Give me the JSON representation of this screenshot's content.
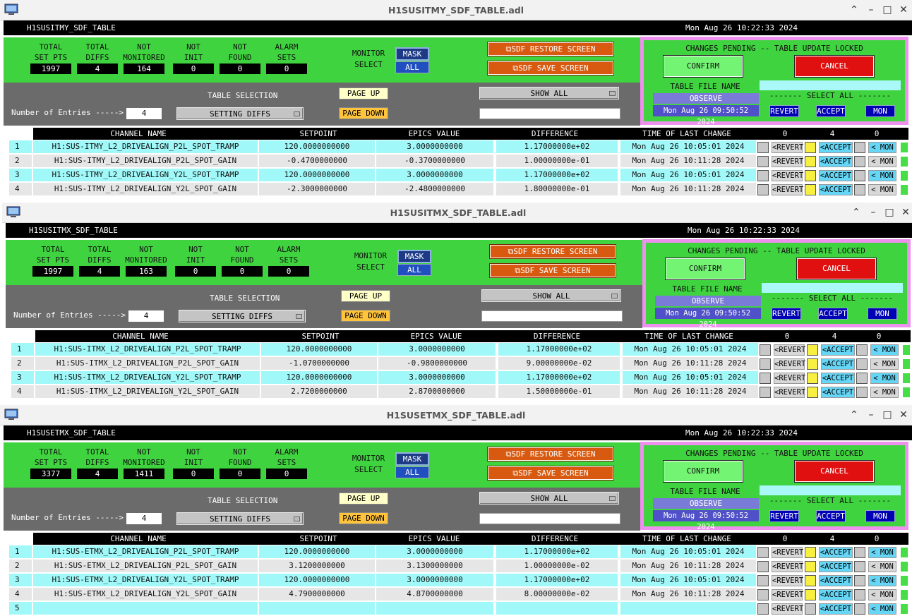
{
  "windows": [
    {
      "title": "H1SUSITMY_SDF_TABLE.adl",
      "header_name": "H1SUSITMY_SDF_TABLE",
      "header_date": "Mon Aug 26 10:22:33 2024",
      "stats": [
        {
          "label1": "TOTAL",
          "label2": "SET PTS",
          "value": "1997"
        },
        {
          "label1": "TOTAL",
          "label2": "DIFFS",
          "value": "4"
        },
        {
          "label1": "NOT",
          "label2": "MONITORED",
          "value": "164"
        },
        {
          "label1": "NOT",
          "label2": "INIT",
          "value": "0"
        },
        {
          "label1": "NOT",
          "label2": "FOUND",
          "value": "0"
        },
        {
          "label1": "ALARM",
          "label2": "SETS",
          "value": "0"
        }
      ],
      "monitor_select_1": "MONITOR",
      "monitor_select_2": "SELECT",
      "mask_label": "MASK",
      "all_label": "ALL",
      "restore_label": "⧉SDF RESTORE SCREEN",
      "save_label": "⧉SDF SAVE SCREEN",
      "table_selection_label": "TABLE SELECTION",
      "entries_label": "Number of Entries ----->",
      "entries_value": "4",
      "table_select_value": "SETTING DIFFS",
      "page_up": "PAGE UP",
      "page_down": "PAGE DOWN",
      "show_all": "SHOW ALL",
      "pending_text": "CHANGES PENDING -- TABLE UPDATE LOCKED",
      "confirm": "CONFIRM",
      "cancel": "CANCEL",
      "table_file_name": "TABLE FILE NAME",
      "observe": "OBSERVE",
      "select_all": "------- SELECT ALL -------",
      "file_date": "Mon Aug 26 09:50:52 2024",
      "revert_all": "REVERT",
      "accept_all": "ACCEPT",
      "mon_all": "MON",
      "columns": [
        "CHANNEL NAME",
        "SETPOINT",
        "EPICS VALUE",
        "DIFFERENCE",
        "TIME OF LAST CHANGE",
        "0",
        "4",
        "0"
      ],
      "rows": [
        {
          "idx": "1",
          "channel": "H1:SUS-ITMY_L2_DRIVEALIGN_P2L_SPOT_TRAMP",
          "setpoint": "120.0000000000",
          "epics": "3.0000000000",
          "diff": "1.17000000e+02",
          "time": "Mon Aug 26 10:05:01 2024"
        },
        {
          "idx": "2",
          "channel": "H1:SUS-ITMY_L2_DRIVEALIGN_P2L_SPOT_GAIN",
          "setpoint": "-0.4700000000",
          "epics": "-0.3700000000",
          "diff": "1.00000000e-01",
          "time": "Mon Aug 26 10:11:28 2024"
        },
        {
          "idx": "3",
          "channel": "H1:SUS-ITMY_L2_DRIVEALIGN_Y2L_SPOT_TRAMP",
          "setpoint": "120.0000000000",
          "epics": "3.0000000000",
          "diff": "1.17000000e+02",
          "time": "Mon Aug 26 10:05:01 2024"
        },
        {
          "idx": "4",
          "channel": "H1:SUS-ITMY_L2_DRIVEALIGN_Y2L_SPOT_GAIN",
          "setpoint": "-2.3000000000",
          "epics": "-2.4800000000",
          "diff": "1.80000000e-01",
          "time": "Mon Aug 26 10:11:28 2024"
        }
      ],
      "row_revert": "<REVERT",
      "row_accept": "<ACCEPT",
      "row_mon": "< MON"
    },
    {
      "title": "H1SUSITMX_SDF_TABLE.adl",
      "header_name": "H1SUSITMX_SDF_TABLE",
      "header_date": "Mon Aug 26 10:22:33 2024",
      "stats": [
        {
          "label1": "TOTAL",
          "label2": "SET PTS",
          "value": "1997"
        },
        {
          "label1": "TOTAL",
          "label2": "DIFFS",
          "value": "4"
        },
        {
          "label1": "NOT",
          "label2": "MONITORED",
          "value": "163"
        },
        {
          "label1": "NOT",
          "label2": "INIT",
          "value": "0"
        },
        {
          "label1": "NOT",
          "label2": "FOUND",
          "value": "0"
        },
        {
          "label1": "ALARM",
          "label2": "SETS",
          "value": "0"
        }
      ],
      "monitor_select_1": "MONITOR",
      "monitor_select_2": "SELECT",
      "mask_label": "MASK",
      "all_label": "ALL",
      "restore_label": "⧉SDF RESTORE SCREEN",
      "save_label": "⧉SDF SAVE SCREEN",
      "table_selection_label": "TABLE SELECTION",
      "entries_label": "Number of Entries ----->",
      "entries_value": "4",
      "table_select_value": "SETTING DIFFS",
      "page_up": "PAGE UP",
      "page_down": "PAGE DOWN",
      "show_all": "SHOW ALL",
      "pending_text": "CHANGES PENDING -- TABLE UPDATE LOCKED",
      "confirm": "CONFIRM",
      "cancel": "CANCEL",
      "table_file_name": "TABLE FILE NAME",
      "observe": "OBSERVE",
      "select_all": "------- SELECT ALL -------",
      "file_date": "Mon Aug 26 09:50:52 2024",
      "revert_all": "REVERT",
      "accept_all": "ACCEPT",
      "mon_all": "MON",
      "columns": [
        "CHANNEL NAME",
        "SETPOINT",
        "EPICS VALUE",
        "DIFFERENCE",
        "TIME OF LAST CHANGE",
        "0",
        "4",
        "0"
      ],
      "rows": [
        {
          "idx": "1",
          "channel": "H1:SUS-ITMX_L2_DRIVEALIGN_P2L_SPOT_TRAMP",
          "setpoint": "120.0000000000",
          "epics": "3.0000000000",
          "diff": "1.17000000e+02",
          "time": "Mon Aug 26 10:05:01 2024"
        },
        {
          "idx": "2",
          "channel": "H1:SUS-ITMX_L2_DRIVEALIGN_P2L_SPOT_GAIN",
          "setpoint": "-1.0700000000",
          "epics": "-0.9800000000",
          "diff": "9.00000000e-02",
          "time": "Mon Aug 26 10:11:28 2024"
        },
        {
          "idx": "3",
          "channel": "H1:SUS-ITMX_L2_DRIVEALIGN_Y2L_SPOT_TRAMP",
          "setpoint": "120.0000000000",
          "epics": "3.0000000000",
          "diff": "1.17000000e+02",
          "time": "Mon Aug 26 10:05:01 2024"
        },
        {
          "idx": "4",
          "channel": "H1:SUS-ITMX_L2_DRIVEALIGN_Y2L_SPOT_GAIN",
          "setpoint": "2.7200000000",
          "epics": "2.8700000000",
          "diff": "1.50000000e-01",
          "time": "Mon Aug 26 10:11:28 2024"
        }
      ],
      "row_revert": "<REVERT",
      "row_accept": "<ACCEPT",
      "row_mon": "< MON"
    },
    {
      "title": "H1SUSETMX_SDF_TABLE.adl",
      "header_name": "H1SUSETMX_SDF_TABLE",
      "header_date": "Mon Aug 26 10:22:33 2024",
      "stats": [
        {
          "label1": "TOTAL",
          "label2": "SET PTS",
          "value": "3377"
        },
        {
          "label1": "TOTAL",
          "label2": "DIFFS",
          "value": "4"
        },
        {
          "label1": "NOT",
          "label2": "MONITORED",
          "value": "1411"
        },
        {
          "label1": "NOT",
          "label2": "INIT",
          "value": "0"
        },
        {
          "label1": "NOT",
          "label2": "FOUND",
          "value": "0"
        },
        {
          "label1": "ALARM",
          "label2": "SETS",
          "value": "0"
        }
      ],
      "monitor_select_1": "MONITOR",
      "monitor_select_2": "SELECT",
      "mask_label": "MASK",
      "all_label": "ALL",
      "restore_label": "⧉SDF RESTORE SCREEN",
      "save_label": "⧉SDF SAVE SCREEN",
      "table_selection_label": "TABLE SELECTION",
      "entries_label": "Number of Entries ----->",
      "entries_value": "4",
      "table_select_value": "SETTING DIFFS",
      "page_up": "PAGE UP",
      "page_down": "PAGE DOWN",
      "show_all": "SHOW ALL",
      "pending_text": "CHANGES PENDING -- TABLE UPDATE LOCKED",
      "confirm": "CONFIRM",
      "cancel": "CANCEL",
      "table_file_name": "TABLE FILE NAME",
      "observe": "OBSERVE",
      "select_all": "------- SELECT ALL -------",
      "file_date": "Mon Aug 26 09:50:52 2024",
      "revert_all": "REVERT",
      "accept_all": "ACCEPT",
      "mon_all": "MON",
      "columns": [
        "CHANNEL NAME",
        "SETPOINT",
        "EPICS VALUE",
        "DIFFERENCE",
        "TIME OF LAST CHANGE",
        "0",
        "4",
        "0"
      ],
      "rows": [
        {
          "idx": "1",
          "channel": "H1:SUS-ETMX_L2_DRIVEALIGN_P2L_SPOT_TRAMP",
          "setpoint": "120.0000000000",
          "epics": "3.0000000000",
          "diff": "1.17000000e+02",
          "time": "Mon Aug 26 10:05:01 2024"
        },
        {
          "idx": "2",
          "channel": "H1:SUS-ETMX_L2_DRIVEALIGN_P2L_SPOT_GAIN",
          "setpoint": "3.1200000000",
          "epics": "3.1300000000",
          "diff": "1.00000000e-02",
          "time": "Mon Aug 26 10:11:28 2024"
        },
        {
          "idx": "3",
          "channel": "H1:SUS-ETMX_L2_DRIVEALIGN_Y2L_SPOT_TRAMP",
          "setpoint": "120.0000000000",
          "epics": "3.0000000000",
          "diff": "1.17000000e+02",
          "time": "Mon Aug 26 10:05:01 2024"
        },
        {
          "idx": "4",
          "channel": "H1:SUS-ETMX_L2_DRIVEALIGN_Y2L_SPOT_GAIN",
          "setpoint": "4.7900000000",
          "epics": "4.8700000000",
          "diff": "8.00000000e-02",
          "time": "Mon Aug 26 10:11:28 2024"
        },
        {
          "idx": "5",
          "channel": "",
          "setpoint": "",
          "epics": "",
          "diff": "",
          "time": ""
        }
      ],
      "row_revert": "<REVERT",
      "row_accept": "<ACCEPT",
      "row_mon": "< MON"
    }
  ],
  "colors": {
    "panel_green": "#3fd43f",
    "cyan_row": "#a0f8f8",
    "light_row": "#e6e6e6",
    "pending_border": "#ee90ee",
    "cancel_red": "#e01010"
  },
  "icons": {
    "app": "monitor-icon",
    "minimize": "minimize-icon",
    "maximize": "maximize-icon",
    "close": "close-icon",
    "chevron": "chevron-up-icon"
  }
}
